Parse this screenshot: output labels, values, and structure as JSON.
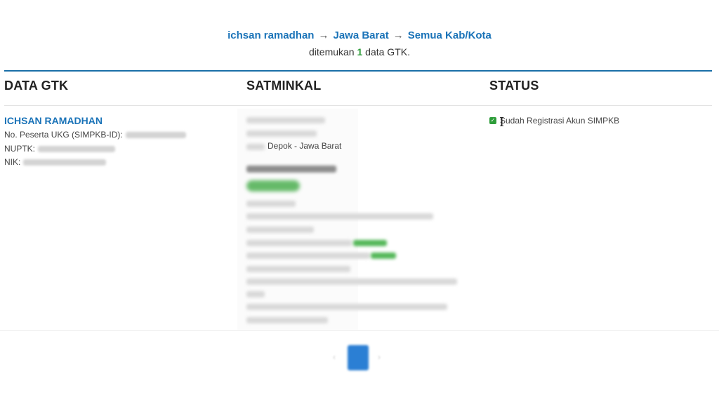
{
  "breadcrumb": {
    "user": "ichsan ramadhan",
    "region": "Jawa Barat",
    "district": "Semua Kab/Kota",
    "separator": "→"
  },
  "result": {
    "prefix": "ditemukan",
    "count": "1",
    "suffix": "data GTK."
  },
  "columns": {
    "gtk": "DATA GTK",
    "satminkal": "SATMINKAL",
    "status": "STATUS"
  },
  "gtk": {
    "name": "ICHSAN RAMADHAN",
    "peserta_label": "No. Peserta UKG (SIMPKB-ID):",
    "nuptk_label": "NUPTK:",
    "nik_label": "NIK:"
  },
  "satminkal": {
    "location": "Depok - Jawa Barat"
  },
  "status": {
    "text": "Sudah Registrasi Akun SIMPKB",
    "check": "✓"
  },
  "colors": {
    "link": "#1a73b8",
    "accent_green": "#2e9d3a",
    "rule": "#1a6fa8",
    "pager": "#2b7fd4"
  },
  "pagination": {
    "prev": "‹",
    "next": "›"
  }
}
